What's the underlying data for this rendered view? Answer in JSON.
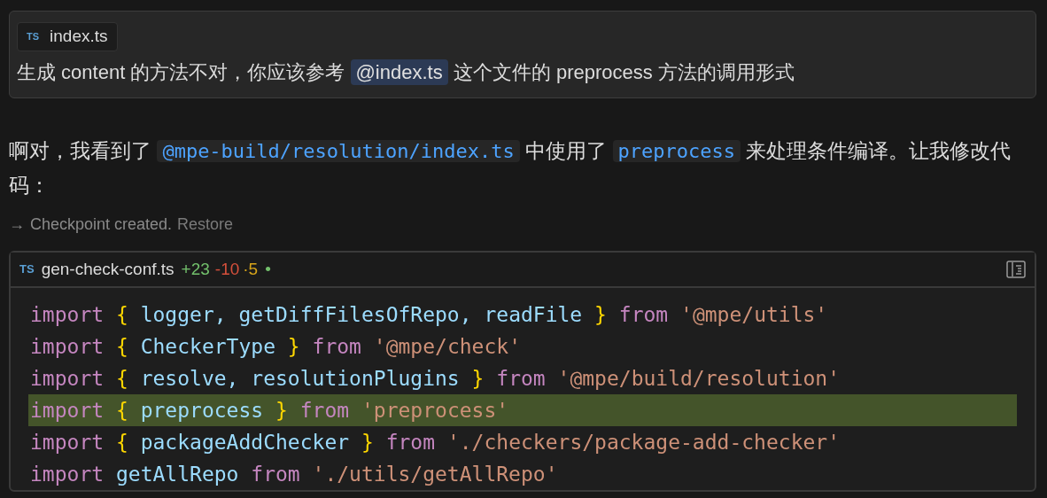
{
  "user_message": {
    "attachment": {
      "badge": "TS",
      "name": "index.ts"
    },
    "segments": [
      {
        "kind": "text",
        "text": "生成 content 的方法不对，你应该参考 "
      },
      {
        "kind": "mention",
        "text": "@index.ts"
      },
      {
        "kind": "text",
        "text": " 这个文件的 preprocess 方法的调用形式"
      }
    ]
  },
  "assistant_message": {
    "segments": [
      {
        "kind": "text",
        "text": "啊对，我看到了 "
      },
      {
        "kind": "code",
        "text": "@mpe-build/resolution/index.ts"
      },
      {
        "kind": "text",
        "text": " 中使用了 "
      },
      {
        "kind": "code",
        "text": "preprocess"
      },
      {
        "kind": "text",
        "text": " 来处理条件编译。让我修改代码："
      }
    ]
  },
  "checkpoint": {
    "arrow": "→",
    "text": "Checkpoint created.",
    "action": "Restore"
  },
  "code_block": {
    "badge": "TS",
    "filename": "gen-check-conf.ts",
    "added": "+23",
    "removed": "-10",
    "modified": "·5",
    "status_dot": "•",
    "lines": [
      {
        "added": false,
        "tokens": [
          {
            "kind": "keyword",
            "text": "import"
          },
          {
            "kind": "brace",
            "text": "{"
          },
          {
            "kind": "ident",
            "text": "logger,"
          },
          {
            "kind": "ident",
            "text": "getDiffFilesOfRepo,"
          },
          {
            "kind": "ident",
            "text": "readFile"
          },
          {
            "kind": "brace",
            "text": "}"
          },
          {
            "kind": "keyword",
            "text": "from"
          },
          {
            "kind": "string",
            "text": "'@mpe/utils'"
          }
        ]
      },
      {
        "added": false,
        "tokens": [
          {
            "kind": "keyword",
            "text": "import"
          },
          {
            "kind": "brace",
            "text": "{"
          },
          {
            "kind": "ident",
            "text": "CheckerType"
          },
          {
            "kind": "brace",
            "text": "}"
          },
          {
            "kind": "keyword",
            "text": "from"
          },
          {
            "kind": "string",
            "text": "'@mpe/check'"
          }
        ]
      },
      {
        "added": false,
        "tokens": [
          {
            "kind": "keyword",
            "text": "import"
          },
          {
            "kind": "brace",
            "text": "{"
          },
          {
            "kind": "ident",
            "text": "resolve,"
          },
          {
            "kind": "ident",
            "text": "resolutionPlugins"
          },
          {
            "kind": "brace",
            "text": "}"
          },
          {
            "kind": "keyword",
            "text": "from"
          },
          {
            "kind": "string",
            "text": "'@mpe/build/resolution'"
          }
        ]
      },
      {
        "added": true,
        "tokens": [
          {
            "kind": "keyword",
            "text": "import"
          },
          {
            "kind": "brace",
            "text": "{"
          },
          {
            "kind": "ident",
            "text": "preprocess"
          },
          {
            "kind": "brace",
            "text": "}"
          },
          {
            "kind": "keyword",
            "text": "from"
          },
          {
            "kind": "string",
            "text": "'preprocess'"
          }
        ]
      },
      {
        "added": false,
        "tokens": [
          {
            "kind": "keyword",
            "text": "import"
          },
          {
            "kind": "brace",
            "text": "{"
          },
          {
            "kind": "ident",
            "text": "packageAddChecker"
          },
          {
            "kind": "brace",
            "text": "}"
          },
          {
            "kind": "keyword",
            "text": "from"
          },
          {
            "kind": "string",
            "text": "'./checkers/package-add-checker'"
          }
        ]
      },
      {
        "added": false,
        "tokens": [
          {
            "kind": "keyword",
            "text": "import"
          },
          {
            "kind": "ident",
            "text": "getAllRepo"
          },
          {
            "kind": "keyword",
            "text": "from"
          },
          {
            "kind": "string",
            "text": "'./utils/getAllRepo'"
          }
        ]
      }
    ]
  }
}
